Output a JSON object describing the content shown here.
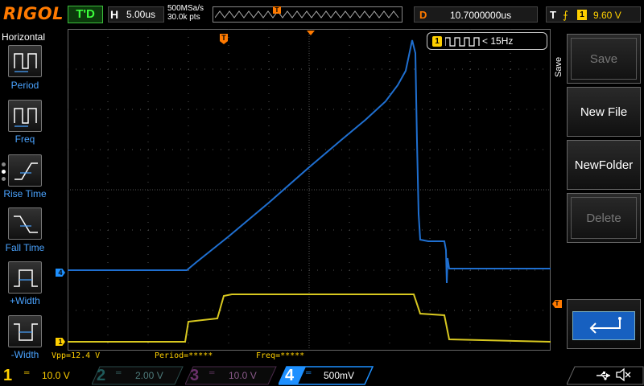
{
  "top": {
    "logo": "RIGOL",
    "trigger_status": "T'D",
    "horizontal": {
      "letter": "H",
      "value": "5.00us"
    },
    "sample_rate": "500MSa/s",
    "memory_depth": "30.0k pts",
    "delay": {
      "letter": "D",
      "value": "10.7000000us"
    },
    "trigger": {
      "letter": "T",
      "edge": "⨍",
      "source": "1",
      "level": "9.60 V"
    }
  },
  "left_menu": {
    "title": "Horizontal",
    "items": [
      {
        "label": "Period",
        "icon": "period-icon"
      },
      {
        "label": "Freq",
        "icon": "freq-icon"
      },
      {
        "label": "Rise Time",
        "icon": "rise-time-icon"
      },
      {
        "label": "Fall Time",
        "icon": "fall-time-icon"
      },
      {
        "label": "+Width",
        "icon": "pos-width-icon"
      },
      {
        "label": "-Width",
        "icon": "neg-width-icon"
      }
    ]
  },
  "frequency_counter": {
    "source": "1",
    "text": "< 15Hz"
  },
  "markers": {
    "trigger_position": "T",
    "ch4": "4",
    "ch1": "1",
    "trigger_level": "T"
  },
  "measurements": {
    "vpp": "Vpp=12.4 V",
    "period": "Period=*****",
    "freq": "Freq=*****"
  },
  "right_menu": {
    "title": "Save",
    "softkeys": [
      {
        "label": "Save",
        "enabled": false
      },
      {
        "label": "New File",
        "enabled": true
      },
      {
        "label": "NewFolder",
        "enabled": true
      },
      {
        "label": "Delete",
        "enabled": false
      }
    ],
    "back_icon": "return-arrow-icon"
  },
  "channels": [
    {
      "num": "1",
      "coupling": "DC",
      "scale": "10.0 V",
      "color": "#ffd000",
      "active": true
    },
    {
      "num": "2",
      "coupling": "DC",
      "scale": "2.00 V",
      "color": "#00c0c0",
      "active": false
    },
    {
      "num": "3",
      "coupling": "DC",
      "scale": "10.0 V",
      "color": "#e040e0",
      "active": false
    },
    {
      "num": "4",
      "coupling": "DC",
      "scale": "500mV",
      "color": "#1e90ff",
      "active": true
    }
  ],
  "status_icons": [
    "usb-icon",
    "mute-icon"
  ],
  "colors": {
    "ch1_trace": "#d8c820",
    "ch4_trace": "#1f6fd0",
    "accent": "#ff7a00",
    "grid": "#555555"
  }
}
